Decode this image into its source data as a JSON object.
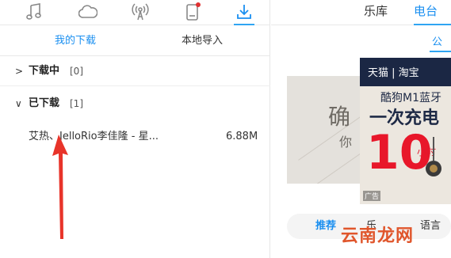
{
  "top_icons": [
    "music-note-icon",
    "cloud-icon",
    "radio-broadcast-icon",
    "device-icon",
    "download-icon"
  ],
  "colors": {
    "accent": "#1a8ff0",
    "notification_dot": "#e03030",
    "arrow": "#e8342a",
    "ad_red": "#e8172a",
    "ad_navy": "#1b2744",
    "watermark": "#e0562c"
  },
  "subtabs": {
    "my_downloads": "我的下载",
    "local_import": "本地导入"
  },
  "downloading": {
    "chevron": ">",
    "title": "下载中",
    "count": "[0]"
  },
  "downloaded": {
    "chevron": "∨",
    "title": "已下载",
    "count": "[1]"
  },
  "file": {
    "name": "艾热、JelloRio李佳隆 - 星...",
    "size": "6.88M"
  },
  "right_tabs": {
    "library": "乐库",
    "radio": "电台"
  },
  "right_sub": "公",
  "album": {
    "chars": [
      "确",
      "你"
    ]
  },
  "ad": {
    "platform": "天猫 | 淘宝",
    "line1": "酷狗M1蓝牙",
    "line2": "一次充电",
    "line3": "小时",
    "big": "10",
    "label": "广告"
  },
  "bottom_tabs": {
    "recommend": "推荐",
    "fragment": "乐",
    "language": "语言"
  },
  "watermark": "云南龙网"
}
